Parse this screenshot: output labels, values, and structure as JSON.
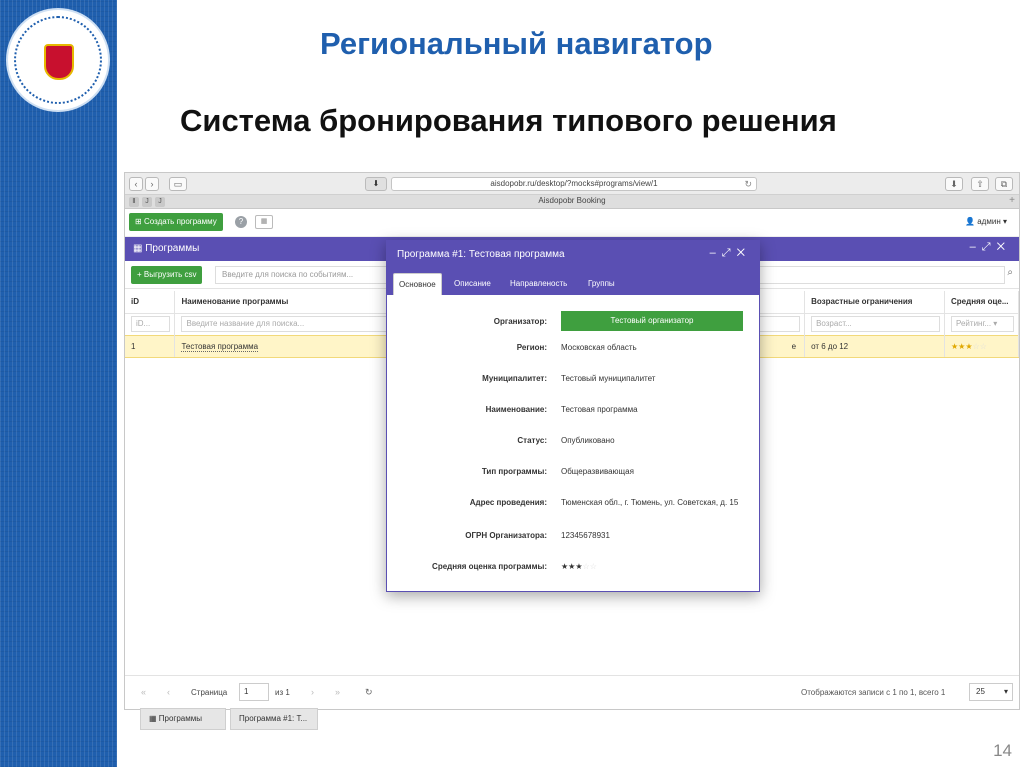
{
  "slide": {
    "title": "Региональный навигатор",
    "subtitle": "Система бронирования типового решения",
    "page_number": "14"
  },
  "browser": {
    "url": "aisdopobr.ru/desktop/?mocks#programs/view/1",
    "tab_title": "Aisdopobr Booking"
  },
  "app": {
    "create_button": "Создать программу",
    "user": "админ",
    "panel_title": "Программы",
    "export_button": "Выгрузить csv",
    "search_placeholder": "Введите для поиска по событиям..."
  },
  "grid": {
    "columns": [
      "iD",
      "Наименование программы",
      "Возрастные ограничения",
      "Средняя оце..."
    ],
    "filters": {
      "id": "iD...",
      "name": "Введите название для поиска...",
      "age": "Возраст...",
      "rating": "Рейтинг..."
    },
    "rows": [
      {
        "id": "1",
        "name": "Тестовая программа",
        "partial": "е",
        "age": "от 6 до 12",
        "rating": 3
      }
    ]
  },
  "pagination": {
    "page_label": "Страница",
    "page": "1",
    "of": "из 1",
    "summary": "Отображаются записи с 1 по 1, всего 1",
    "page_size": "25"
  },
  "bottom_tabs": [
    "Программы",
    "Программа #1: Т..."
  ],
  "modal": {
    "title": "Программа #1: Тестовая программа",
    "tabs": [
      "Основное",
      "Описание",
      "Направленость",
      "Группы"
    ],
    "fields": [
      {
        "label": "Организатор:",
        "value": "Тестовый организатор"
      },
      {
        "label": "Регион:",
        "value": "Московская область"
      },
      {
        "label": "Муниципалитет:",
        "value": "Тестовый муниципалитет"
      },
      {
        "label": "Наименование:",
        "value": "Тестовая программа"
      },
      {
        "label": "Статус:",
        "value": "Опубликовано"
      },
      {
        "label": "Тип программы:",
        "value": "Общеразвивающая"
      },
      {
        "label": "Адрес проведения:",
        "value": "Тюменская обл., г. Тюмень, ул. Советская, д. 15"
      },
      {
        "label": "ОГРН Организатора:",
        "value": "12345678931"
      },
      {
        "label": "Средняя оценка программы:",
        "value": ""
      }
    ],
    "rating": 3
  },
  "colors": {
    "brand_blue": "#1f5fae",
    "header_purple": "#5a4fb3",
    "button_green": "#3f9f3f",
    "selected_row": "#fff5c8"
  }
}
